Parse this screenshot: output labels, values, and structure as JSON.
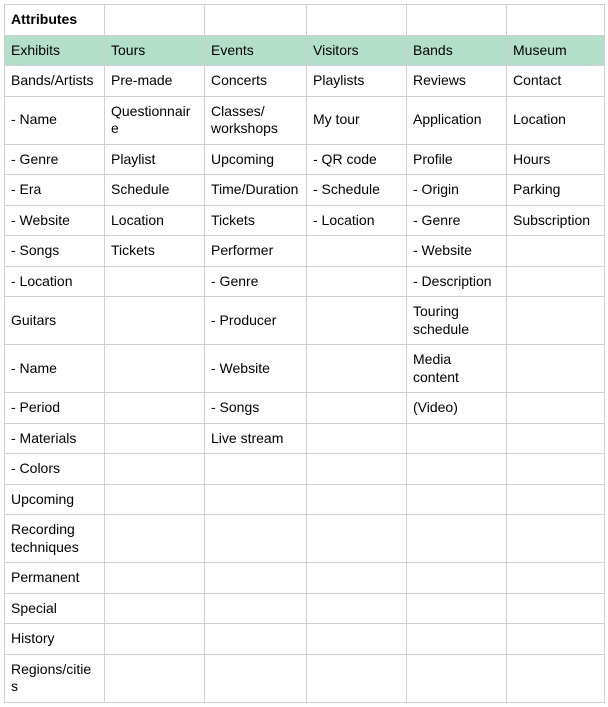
{
  "title": "Attributes",
  "headers": [
    "Exhibits",
    "Tours",
    "Events",
    "Visitors",
    "Bands",
    "Museum"
  ],
  "rows": [
    [
      "Bands/Artists",
      "Pre-made",
      "Concerts",
      "Playlists",
      "Reviews",
      "Contact"
    ],
    [
      " - Name",
      "Questionnaire",
      "Classes/\nworkshops",
      "My tour",
      "Application",
      "Location"
    ],
    [
      " - Genre",
      "Playlist",
      "Upcoming",
      " - QR code",
      "Profile",
      "Hours"
    ],
    [
      " - Era",
      "Schedule",
      "Time/Duration",
      " - Schedule",
      " - Origin",
      "Parking"
    ],
    [
      " - Website",
      "Location",
      "Tickets",
      " - Location",
      " - Genre",
      "Subscription"
    ],
    [
      " - Songs",
      "Tickets",
      "Performer",
      "",
      " - Website",
      ""
    ],
    [
      " - Location",
      "",
      " - Genre",
      "",
      " - Description",
      ""
    ],
    [
      "Guitars",
      "",
      " - Producer",
      "",
      "Touring schedule",
      ""
    ],
    [
      " - Name",
      "",
      " - Website",
      "",
      "Media content",
      ""
    ],
    [
      " - Period",
      "",
      " - Songs",
      "",
      "(Video)",
      ""
    ],
    [
      " - Materials",
      "",
      "Live stream",
      "",
      "",
      ""
    ],
    [
      " - Colors",
      "",
      "",
      "",
      "",
      ""
    ],
    [
      "Upcoming",
      "",
      "",
      "",
      "",
      ""
    ],
    [
      "Recording techniques",
      "",
      "",
      "",
      "",
      ""
    ],
    [
      "Permanent",
      "",
      "",
      "",
      "",
      ""
    ],
    [
      "Special",
      "",
      "",
      "",
      "",
      ""
    ],
    [
      "History",
      "",
      "",
      "",
      "",
      ""
    ],
    [
      "Regions/cities",
      "",
      "",
      "",
      "",
      ""
    ]
  ]
}
